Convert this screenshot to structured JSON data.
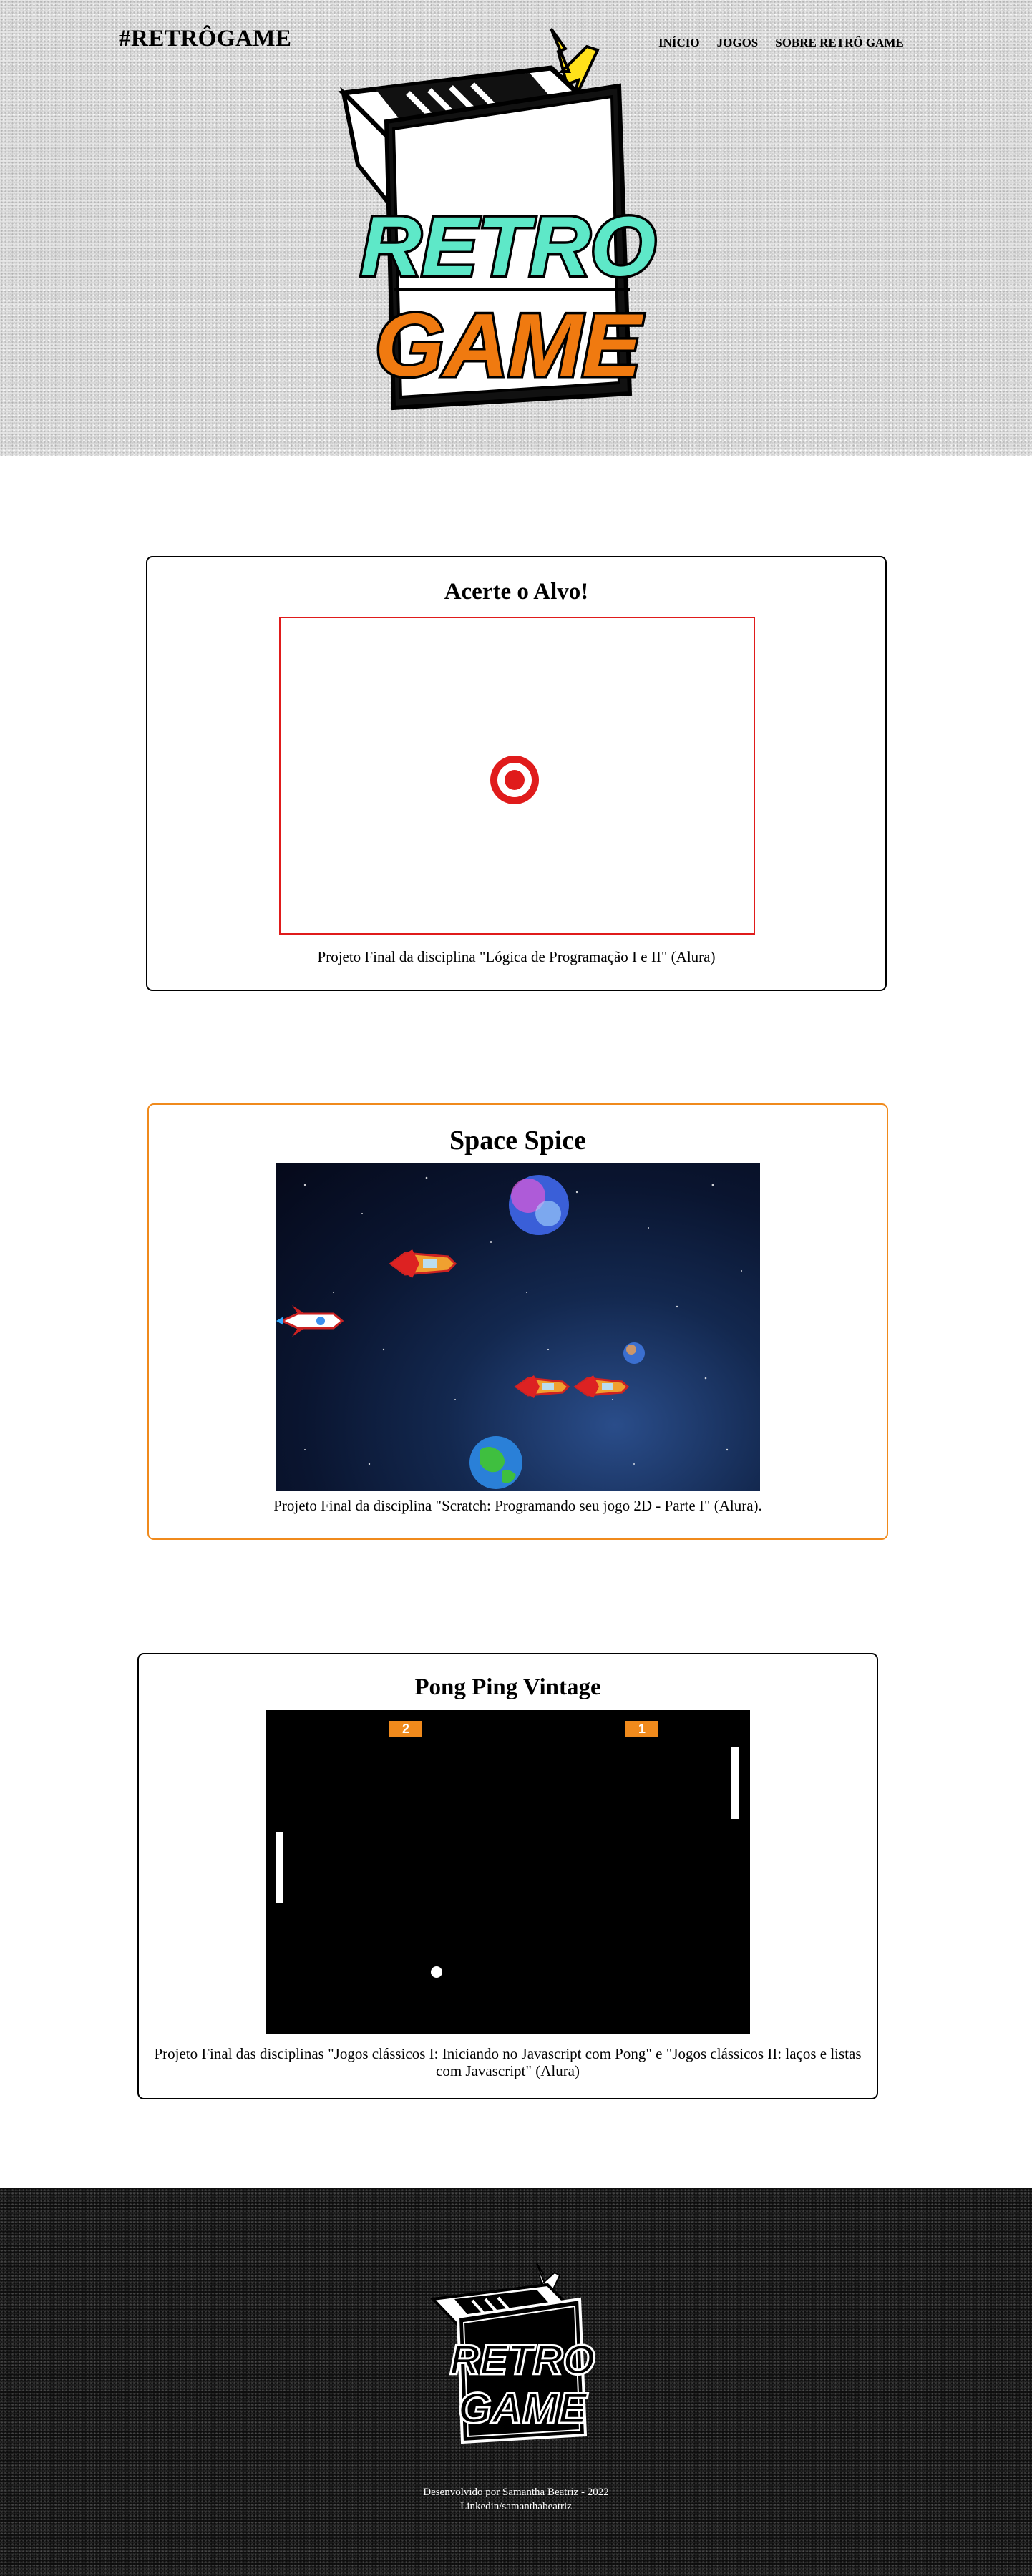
{
  "header": {
    "brand": "#RETRÔGAME",
    "nav": [
      "INÍCIO",
      "JOGOS",
      "SOBRE RETRÔ GAME"
    ],
    "logo_word_1": "RETRO",
    "logo_word_2": "GAME"
  },
  "games": [
    {
      "title": "Acerte o Alvo!",
      "caption": "Projeto Final da disciplina \"Lógica de Programação I e II\" (Alura)"
    },
    {
      "title": "Space Spice",
      "caption": "Projeto Final da disciplina \"Scratch: Programando seu jogo 2D - Parte I\" (Alura)."
    },
    {
      "title": "Pong Ping Vintage",
      "caption": "Projeto Final das disciplinas \"Jogos clássicos I: Iniciando no Javascript com Pong\" e \"Jogos clássicos II: laços e listas com Javascript\" (Alura)",
      "score_left": "2",
      "score_right": "1"
    }
  ],
  "footer": {
    "credit": "Desenvolvido por Samantha Beatriz - 2022",
    "linkedin": "Linkedin/samanthabeatriz"
  },
  "colors": {
    "accent_red": "#e01b1b",
    "accent_orange": "#f08a1c",
    "logo_teal": "#5ee8c8",
    "logo_orange": "#f07a10"
  }
}
